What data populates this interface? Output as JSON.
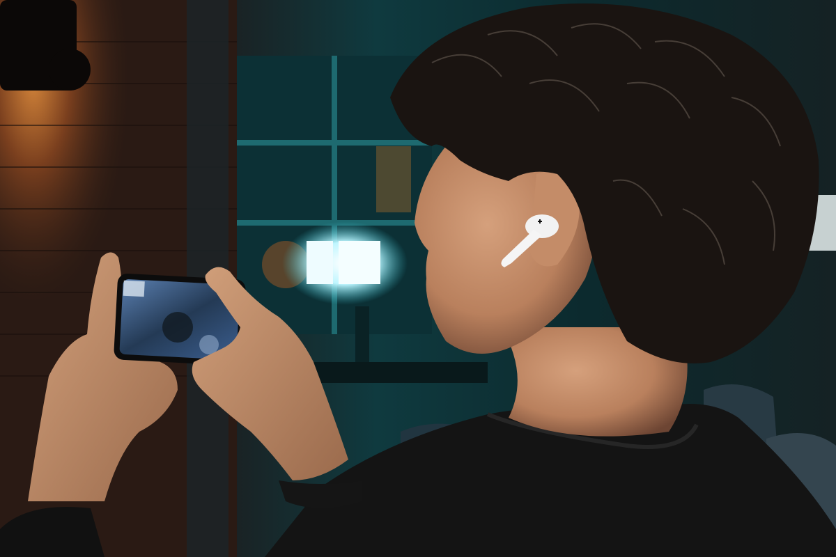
{
  "scene": {
    "kind": "photograph",
    "colors": {
      "brick_wall": "#3a2418",
      "warm_lamp_glow": "#c8742e",
      "teal_room": "#0f3a3f",
      "window_light": "#e8fbff",
      "skin": "#c9916b",
      "hair": "#1a1411",
      "hoodie": "#141414",
      "earbud": "#f2f2f2",
      "phone_screen": "#2b4d7a"
    }
  },
  "icons": {
    "earbud": "earbud-icon",
    "phone": "smartphone-icon"
  }
}
